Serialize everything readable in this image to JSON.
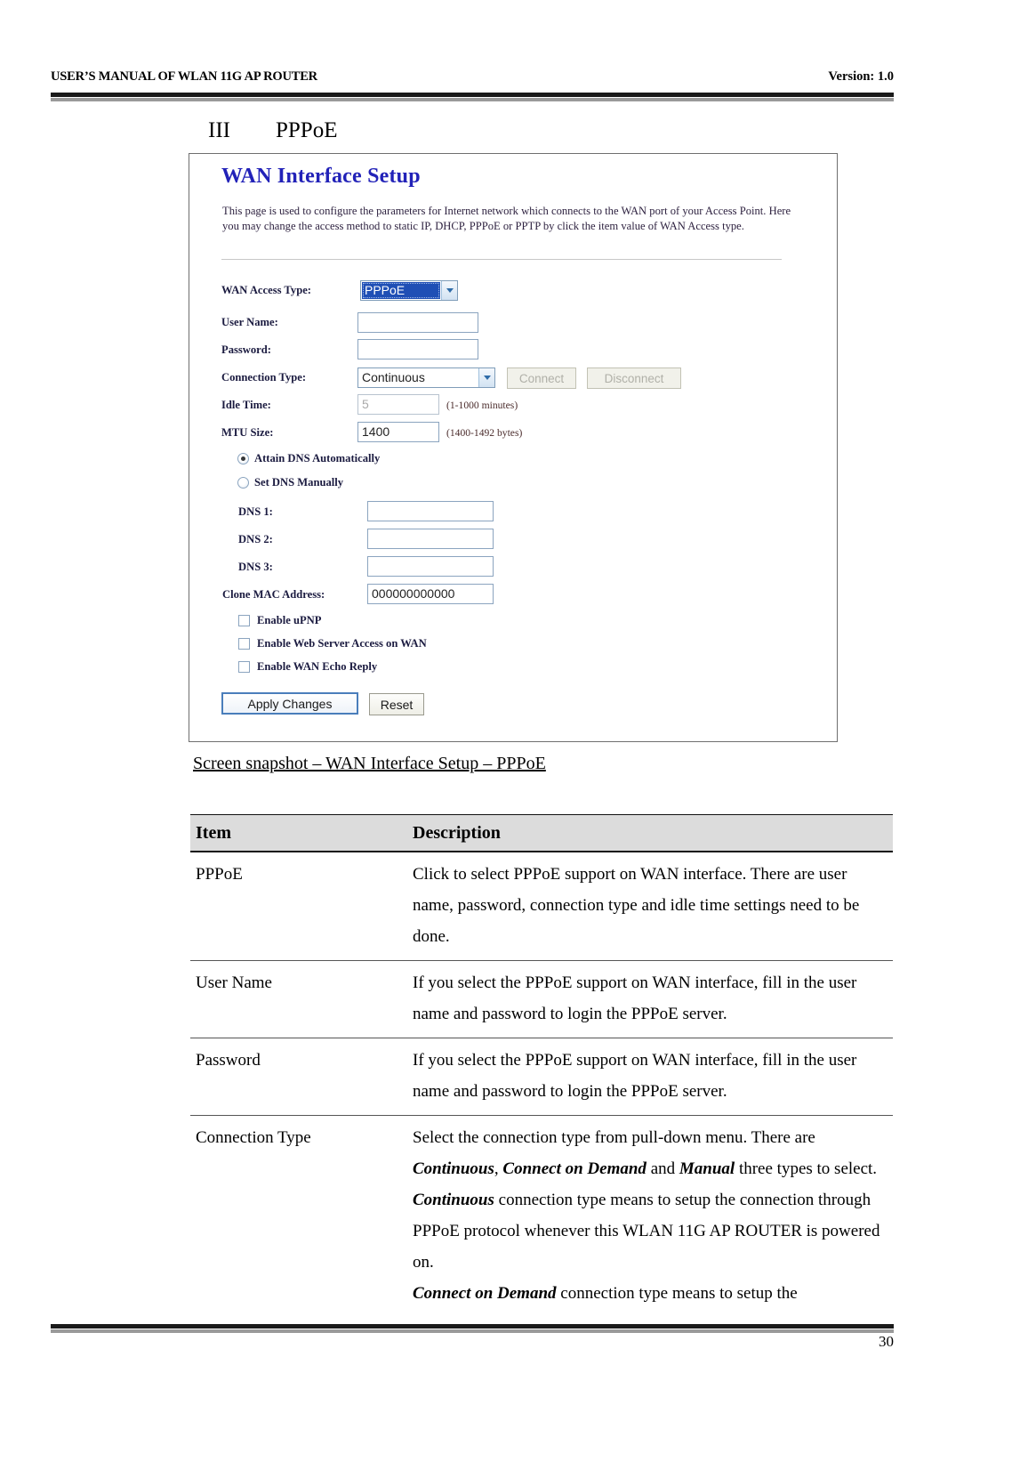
{
  "header": {
    "left_text": "USER’S MANUAL OF WLAN 11G AP ROUTER",
    "right_text": "Version: 1.0"
  },
  "section": {
    "numeral": "III",
    "title": "PPPoE"
  },
  "screenshot": {
    "title": "WAN Interface Setup",
    "description": "This page is used to configure the parameters for Internet network which connects to the WAN port of your Access Point. Here you may change the access method to static IP, DHCP, PPPoE or PPTP by click the item value of WAN Access type.",
    "fields": {
      "wan_access_type_label": "WAN Access Type:",
      "wan_access_type_value": "PPPoE",
      "user_name_label": "User Name:",
      "user_name_value": "",
      "password_label": "Password:",
      "password_value": "",
      "connection_type_label": "Connection Type:",
      "connection_type_value": "Continuous",
      "connect_button": "Connect",
      "disconnect_button": "Disconnect",
      "idle_time_label": "Idle Time:",
      "idle_time_value": "5",
      "idle_time_hint": "(1-1000 minutes)",
      "mtu_size_label": "MTU Size:",
      "mtu_size_value": "1400",
      "mtu_size_hint": "(1400-1492 bytes)",
      "attain_dns_label": "Attain DNS Automatically",
      "set_dns_label": "Set DNS Manually",
      "dns1_label": "DNS 1:",
      "dns1_value": "",
      "dns2_label": "DNS 2:",
      "dns2_value": "",
      "dns3_label": "DNS 3:",
      "dns3_value": "",
      "clone_mac_label": "Clone MAC Address:",
      "clone_mac_value": "000000000000",
      "enable_upnp_label": "Enable uPNP",
      "enable_web_server_label": "Enable Web Server Access on WAN",
      "enable_wan_echo_label": "Enable WAN Echo Reply",
      "apply_button": "Apply Changes",
      "reset_button": "Reset"
    }
  },
  "caption": "Screen snapshot – WAN Interface Setup – PPPoE",
  "table": {
    "headers": {
      "item": "Item",
      "description": "Description"
    },
    "rows": [
      {
        "item": "PPPoE",
        "description": "Click to select PPPoE support on WAN interface. There are user name, password, connection type and idle time settings need to be done."
      },
      {
        "item": "User Name",
        "description": "If you select the PPPoE support on WAN interface, fill in the user name and password to login the PPPoE server."
      },
      {
        "item": "Password",
        "description": "If you select the PPPoE support on WAN interface, fill in the user name and password to login the PPPoE server."
      },
      {
        "item": "Connection Type",
        "description_parts": [
          {
            "text": "Select the connection type from pull-down menu. There are ",
            "style": "normal"
          },
          {
            "text": "Continuous",
            "style": "bold-italic"
          },
          {
            "text": ", ",
            "style": "normal"
          },
          {
            "text": "Connect on Demand",
            "style": "bold-italic"
          },
          {
            "text": " and ",
            "style": "normal"
          },
          {
            "text": "Manual",
            "style": "bold-italic"
          },
          {
            "text": " three types to select.",
            "style": "normal"
          },
          {
            "text": "\n",
            "style": "break"
          },
          {
            "text": "Continuous",
            "style": "bold-italic"
          },
          {
            "text": " connection type means to setup the connection through PPPoE protocol whenever this WLAN 11G AP ROUTER is powered on.",
            "style": "normal"
          },
          {
            "text": "\n",
            "style": "break"
          },
          {
            "text": "Connect on Demand",
            "style": "bold-italic"
          },
          {
            "text": " connection type means to setup the",
            "style": "normal"
          }
        ]
      }
    ]
  },
  "footer": {
    "page_number": "30"
  }
}
